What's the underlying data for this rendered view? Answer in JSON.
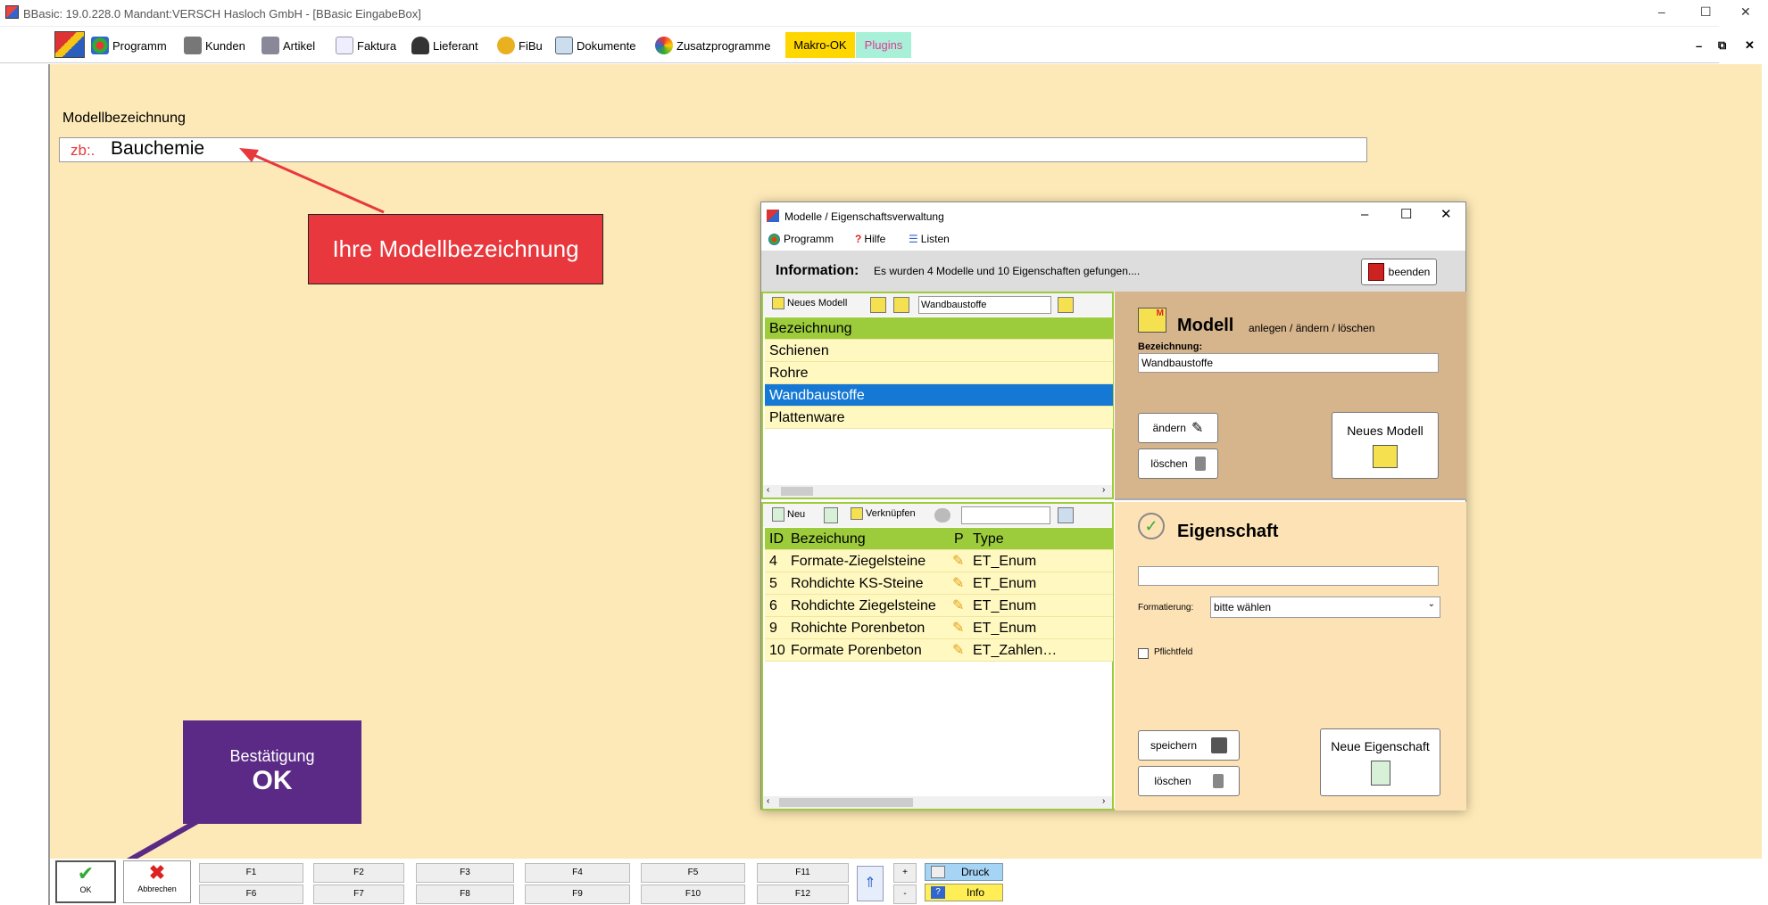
{
  "window": {
    "title": "BBasic: 19.0.228.0 Mandant:VERSCH Hasloch GmbH  - [BBasic EingabeBox]",
    "controls": [
      "–",
      "☐",
      "✕"
    ]
  },
  "menu": {
    "items": [
      "Programm",
      "Kunden",
      "Artikel",
      "Faktura",
      "Lieferant",
      "FiBu",
      "Dokumente",
      "Zusatzprogramme"
    ],
    "makro": "Makro-OK",
    "plugins": "Plugins",
    "mdi_controls": [
      "–",
      "⧉",
      "✕"
    ]
  },
  "form": {
    "label": "Modellbezeichnung",
    "prefix": "zb:.",
    "value": "Bauchemie"
  },
  "callouts": {
    "model_hint": "Ihre Modellbezeichnung",
    "confirm_line1": "Bestätigung",
    "confirm_line2": "OK"
  },
  "dialog": {
    "title": "Modelle / Eigenschaftsverwaltung",
    "menu": [
      "Programm",
      "Hilfe",
      "Listen"
    ],
    "info_label": "Information:",
    "info_text": "Es wurden  4  Modelle  und 10  Eigenschaften gefungen....",
    "close_button": "beenden",
    "models_toolbar": {
      "new_label": "Neues Modell",
      "search_value": "Wandbaustoffe"
    },
    "models": {
      "header": "Bezeichnung",
      "rows": [
        "Schienen",
        "Rohre",
        "Wandbaustoffe",
        "Plattenware"
      ],
      "selected_index": 2
    },
    "props_toolbar": {
      "new_label": "Neu",
      "link_label": "Verknüpfen",
      "search_value": ""
    },
    "properties": {
      "headers": [
        "ID",
        "Bezeichung",
        "P",
        "Type"
      ],
      "rows": [
        {
          "id": "4",
          "name": "Formate-Ziegelsteine",
          "type": "ET_Enum"
        },
        {
          "id": "5",
          "name": "Rohdichte KS-Steine",
          "type": "ET_Enum"
        },
        {
          "id": "6",
          "name": "Rohdichte Ziegelsteine",
          "type": "ET_Enum"
        },
        {
          "id": "9",
          "name": "Rohichte Porenbeton",
          "type": "ET_Enum"
        },
        {
          "id": "10",
          "name": "Formate Porenbeton",
          "type": "ET_Zahlen…"
        }
      ]
    },
    "model_panel": {
      "title": "Modell",
      "subtitle": "anlegen / ändern / löschen",
      "field_label": "Bezeichnung:",
      "field_value": "Wandbaustoffe",
      "change_button": "ändern",
      "delete_button": "löschen",
      "new_button": "Neues  Modell"
    },
    "property_panel": {
      "title": "Eigenschaft",
      "name_value": "",
      "format_label": "Formatierung:",
      "format_value": "bitte wählen",
      "required_label": "Pflichtfeld",
      "save_button": "speichern",
      "delete_button": "löschen",
      "new_button": "Neue Eigenschaft"
    }
  },
  "bottom": {
    "ok": "OK",
    "cancel": "Abbrechen",
    "fkeys_top": [
      "F1",
      "F2",
      "F3",
      "F4",
      "F5",
      "F11"
    ],
    "fkeys_bottom": [
      "F6",
      "F7",
      "F8",
      "F9",
      "F10",
      "F12"
    ],
    "plus": "+",
    "minus": "-",
    "print": "Druck",
    "info": "Info"
  },
  "colors": {
    "background": "#fde9b7",
    "model_panel": "#d6b48c",
    "property_panel": "#fde2b5",
    "list_header": "#9ccc3b",
    "list_row": "#fff8c0",
    "selected": "#1478d4",
    "callout_red": "#e8383d",
    "callout_purple": "#5b2a86",
    "makro": "#ffd700",
    "plugins": "#a8f0d8"
  }
}
